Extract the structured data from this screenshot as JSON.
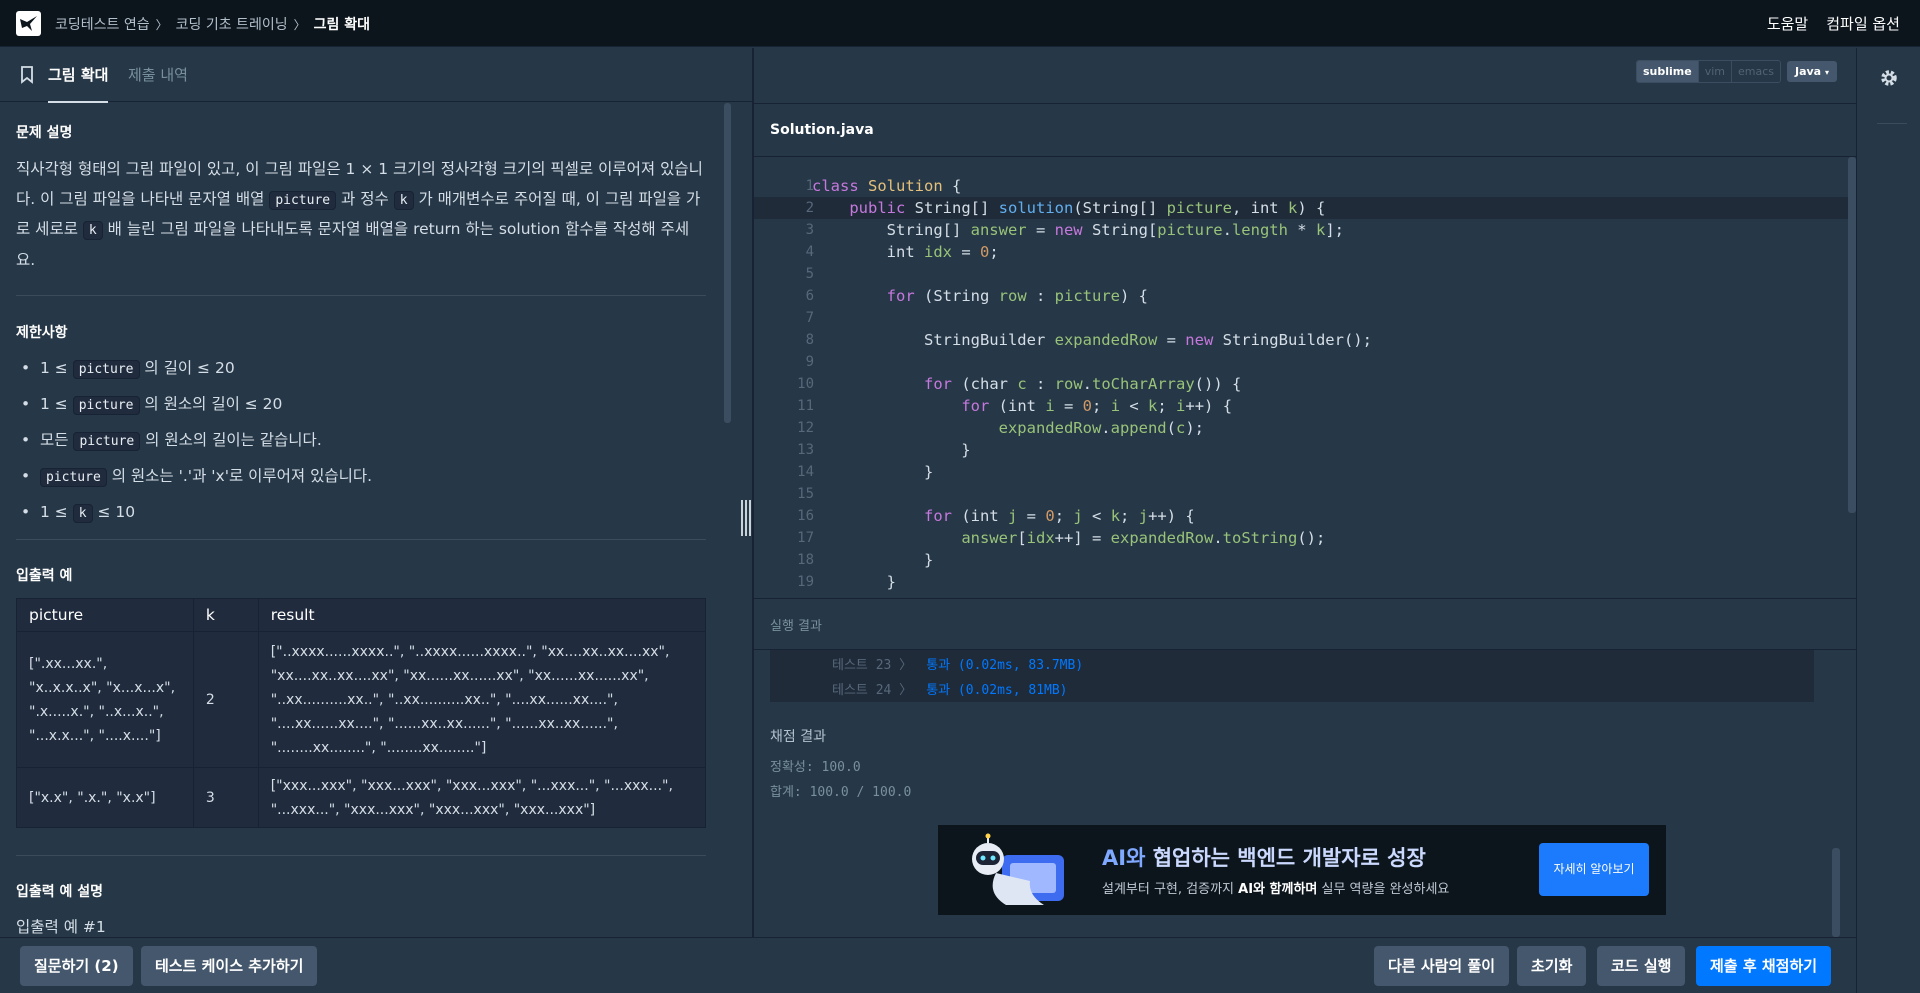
{
  "topnav": {
    "crumbs": [
      "코딩테스트 연습",
      "코딩 기초 트레이닝",
      "그림 확대"
    ],
    "help": "도움말",
    "compile_options": "컴파일 옵션"
  },
  "lefthead": {
    "tab_active": "그림 확대",
    "tab_other": "제출 내역"
  },
  "problem": {
    "desc_title": "문제 설명",
    "desc_parts": [
      "직사각형 형태의 그림 파일이 있고, 이 그림 파일은 1 × 1 크기의 정사각형 크기의 픽셀로 이루어져 있습니다. 이 그림 파일을 나타낸 문자열 배열 ",
      "picture",
      " 과 정수 ",
      "k",
      " 가 매개변수로 주어질 때, 이 그림 파일을 가로 세로로 ",
      "k",
      " 배 늘린 그림 파일을 나타내도록 문자열 배열을 return 하는 solution 함수를 작성해 주세요."
    ],
    "cons_title": "제한사항",
    "cons": [
      {
        "pre": "1 ≤ ",
        "code": "picture",
        "post": " 의 길이 ≤ 20"
      },
      {
        "pre": "1 ≤ ",
        "code": "picture",
        "post": " 의 원소의 길이 ≤ 20"
      },
      {
        "pre": "모든 ",
        "code": "picture",
        "post": " 의 원소의 길이는 같습니다."
      },
      {
        "pre": "",
        "code": "picture",
        "post": " 의 원소는 '.'과 'x'로 이루어져 있습니다."
      },
      {
        "pre": "1 ≤ ",
        "code": "k",
        "post": " ≤ 10"
      }
    ],
    "io_title": "입출력 예",
    "table_headers": [
      "picture",
      "k",
      "result"
    ],
    "table_rows": [
      {
        "picture": "[\".xx...xx.\", \"x..x.x..x\", \"x...x...x\", \".x.....x.\", \"..x...x..\", \"...x.x...\", \"....x....\"]",
        "k": "2",
        "result": "[\"..xxxx......xxxx..\", \"..xxxx......xxxx..\", \"xx....xx..xx....xx\", \"xx....xx..xx....xx\", \"xx......xx......xx\", \"xx......xx......xx\", \"..xx..........xx..\", \"..xx..........xx..\", \"....xx......xx....\", \"....xx......xx....\", \"......xx..xx......\", \"......xx..xx......\", \"........xx........\", \"........xx........\"]"
      },
      {
        "picture": "[\"x.x\", \".x.\", \"x.x\"]",
        "k": "3",
        "result": "[\"xxx...xxx\", \"xxx...xxx\", \"xxx...xxx\", \"...xxx...\", \"...xxx...\", \"...xxx...\", \"xxx...xxx\", \"xxx...xxx\", \"xxx...xxx\"]"
      }
    ],
    "io_desc_title": "입출력 예 설명",
    "io_desc_1": "입출력 예 #1"
  },
  "editor": {
    "keymaps": [
      "sublime",
      "vim",
      "emacs"
    ],
    "language": "Java",
    "filename": "Solution.java",
    "line_numbers": [
      "1",
      "2",
      "3",
      "4",
      "5",
      "6",
      "7",
      "8",
      "9",
      "10",
      "11",
      "12",
      "13",
      "14",
      "15",
      "16",
      "17",
      "18",
      "19"
    ]
  },
  "result": {
    "title": "실행 결과",
    "tests": [
      {
        "label": "테스트 23 〉",
        "status": "통과 (0.02ms, 83.7MB)"
      },
      {
        "label": "테스트 24 〉",
        "status": "통과 (0.02ms, 81MB)"
      }
    ],
    "grade_title": "채점 결과",
    "accuracy": "정확성: 100.0",
    "total": "합계: 100.0 / 100.0"
  },
  "banner": {
    "title_a": "AI와 ",
    "title_b": "협업하는 백엔드 개발자로 성장",
    "sub_a": "설계부터 구현, 검증까지 ",
    "sub_b": "AI와 함께하며",
    "sub_c": " 실무 역량을 완성하세요",
    "button": "자세히 알아보기"
  },
  "footer": {
    "ask": "질문하기 (2)",
    "add_tc": "테스트 케이스 추가하기",
    "others": "다른 사람의 풀이",
    "reset": "초기화",
    "run": "코드 실행",
    "submit": "제출 후 채점하기"
  },
  "colors": {
    "accent": "#0078ff",
    "bg": "#263747",
    "nav": "#0c151c"
  }
}
